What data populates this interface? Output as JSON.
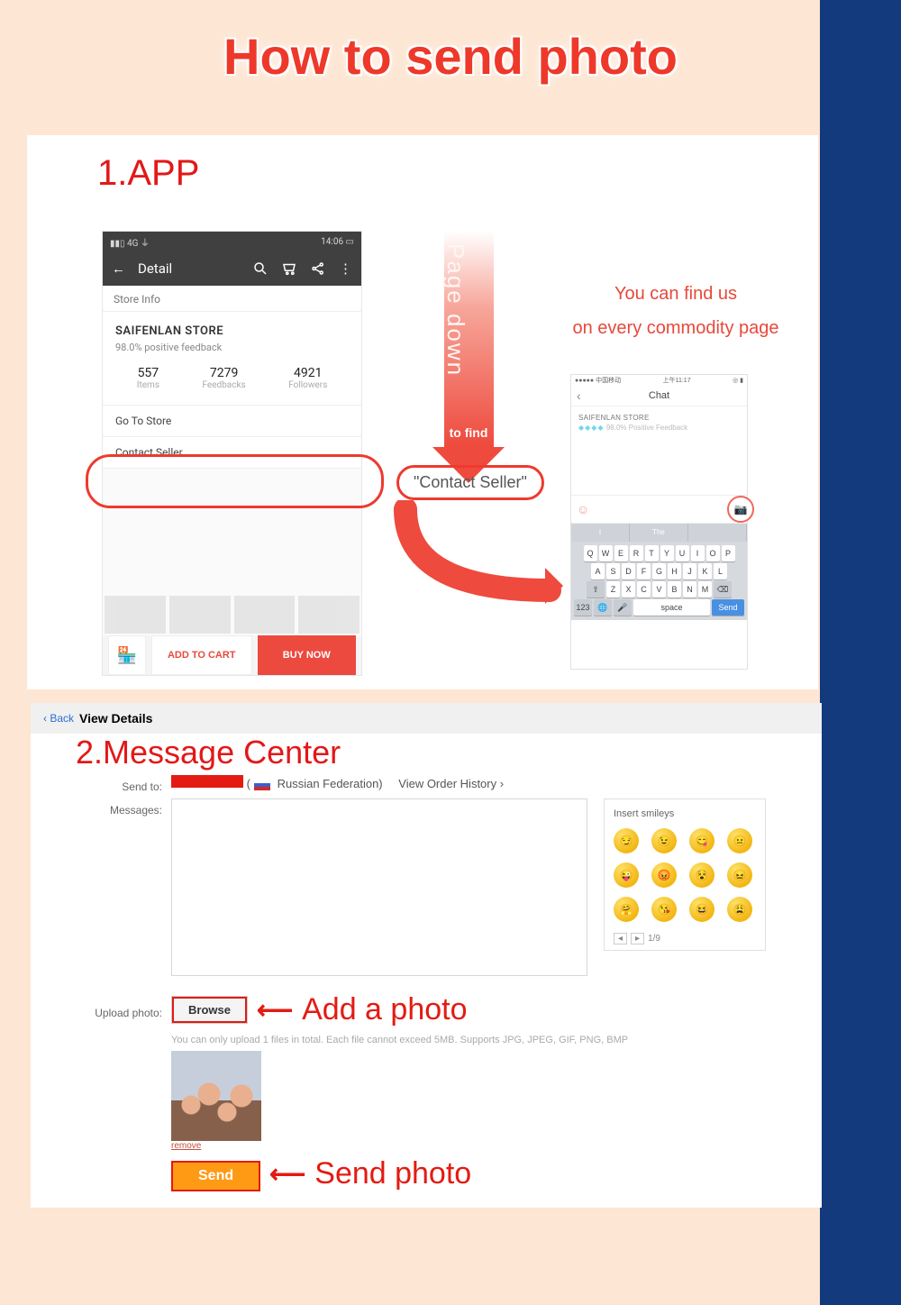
{
  "title": "How to send photo",
  "section1": {
    "heading": "1.APP",
    "sideNote1": "You can find us",
    "sideNote2": "on every commodity page",
    "arrowText": "to find",
    "pageDown": "Page down",
    "contactPill": "\"Contact Seller\""
  },
  "phone1": {
    "statusLeft": "4G",
    "statusRight": "14:06",
    "back": "←",
    "title": "Detail",
    "storeInfoLabel": "Store Info",
    "storeName": "SAIFENLAN STORE",
    "feedback": "98.0% positive feedback",
    "stats": [
      {
        "n": "557",
        "l": "Items"
      },
      {
        "n": "7279",
        "l": "Feedbacks"
      },
      {
        "n": "4921",
        "l": "Followers"
      }
    ],
    "goToStore": "Go To Store",
    "contactSeller": "Contact Seller",
    "addToCart": "ADD TO CART",
    "buyNow": "BUY NOW"
  },
  "phone2": {
    "statusLeft": "●●●●● 中国移动",
    "statusCenter": "上午11:17",
    "title": "Chat",
    "storeName": "SAIFENLAN STORE",
    "feedback": "98.0% Positive Feedback",
    "suggestions": [
      "I",
      "The",
      ""
    ],
    "row1": [
      "Q",
      "W",
      "E",
      "R",
      "T",
      "Y",
      "U",
      "I",
      "O",
      "P"
    ],
    "row2": [
      "A",
      "S",
      "D",
      "F",
      "G",
      "H",
      "J",
      "K",
      "L"
    ],
    "row3": [
      "Z",
      "X",
      "C",
      "V",
      "B",
      "N",
      "M"
    ],
    "k123": "123",
    "space": "space",
    "send": "Send"
  },
  "section2": {
    "back": "‹ Back",
    "viewDetails": "View Details",
    "heading": "2.Message Center",
    "sendToLabel": "Send to:",
    "country": "Russian Federation)",
    "viewOrderHistory": "View Order History ›",
    "messagesLabel": "Messages:",
    "insertSmileys": "Insert smileys",
    "pager": "1/9",
    "uploadLabel": "Upload photo:",
    "browse": "Browse",
    "addPhoto": "Add a photo",
    "hint": "You can only upload 1 files in total. Each file cannot exceed 5MB. Supports JPG, JPEG, GIF, PNG, BMP",
    "remove": "remove",
    "sendBtn": "Send",
    "sendPhoto": "Send photo"
  }
}
